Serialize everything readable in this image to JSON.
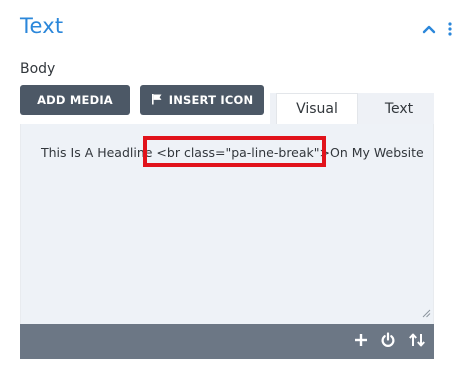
{
  "panel": {
    "title": "Text"
  },
  "field": {
    "label": "Body"
  },
  "buttons": {
    "add_media": "ADD MEDIA",
    "insert_icon": "INSERT ICON"
  },
  "tabs": [
    {
      "label": "Visual"
    },
    {
      "label": "Text"
    }
  ],
  "editor": {
    "content": "This Is A Headline <br class=\"pa-line-break\">On My Website"
  },
  "icons": {
    "collapse": "chevron-up-icon",
    "more": "more-vertical-icon",
    "add": "plus-icon",
    "power": "power-icon",
    "sort": "sort-arrows-icon",
    "flag": "flag-icon"
  },
  "colors": {
    "title": "#2b87da",
    "button_bg": "#4c5866",
    "toolbar_bg": "#6c7785",
    "editor_bg": "#eef2f7",
    "highlight": "#e1131b"
  }
}
